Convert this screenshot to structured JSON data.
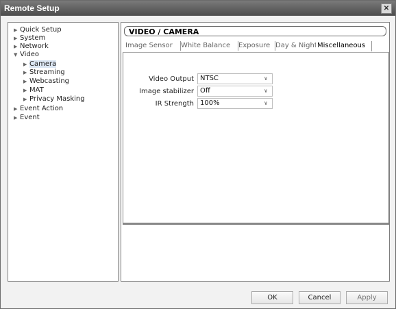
{
  "window": {
    "title": "Remote Setup",
    "close_icon": "close-icon"
  },
  "tree": {
    "items": [
      {
        "label": "Quick Setup",
        "arrow": "▶",
        "level": 0
      },
      {
        "label": "System",
        "arrow": "▶",
        "level": 0
      },
      {
        "label": "Network",
        "arrow": "▶",
        "level": 0
      },
      {
        "label": "Video",
        "arrow": "▼",
        "level": 0
      },
      {
        "label": "Camera",
        "arrow": "▶",
        "level": 1,
        "selected": true
      },
      {
        "label": "Streaming",
        "arrow": "▶",
        "level": 1
      },
      {
        "label": "Webcasting",
        "arrow": "▶",
        "level": 1
      },
      {
        "label": "MAT",
        "arrow": "▶",
        "level": 1
      },
      {
        "label": "Privacy Masking",
        "arrow": "▶",
        "level": 1
      },
      {
        "label": "Event Action",
        "arrow": "▶",
        "level": 0
      },
      {
        "label": "Event",
        "arrow": "▶",
        "level": 0
      }
    ]
  },
  "panel": {
    "header": "VIDEO / CAMERA",
    "tabs": [
      {
        "label": "Image Sensor"
      },
      {
        "label": "White Balance"
      },
      {
        "label": "Exposure"
      },
      {
        "label": "Day & Night"
      },
      {
        "label": "Miscellaneous",
        "active": true
      }
    ],
    "fields": [
      {
        "label": "Video Output",
        "value": "NTSC"
      },
      {
        "label": "Image stabilizer",
        "value": "Off"
      },
      {
        "label": "IR Strength",
        "value": "100%"
      }
    ]
  },
  "buttons": {
    "ok": "OK",
    "cancel": "Cancel",
    "apply": "Apply"
  },
  "colors": {
    "titlebar": "#5a5a5a",
    "selected_bg": "#dbe6f3"
  }
}
